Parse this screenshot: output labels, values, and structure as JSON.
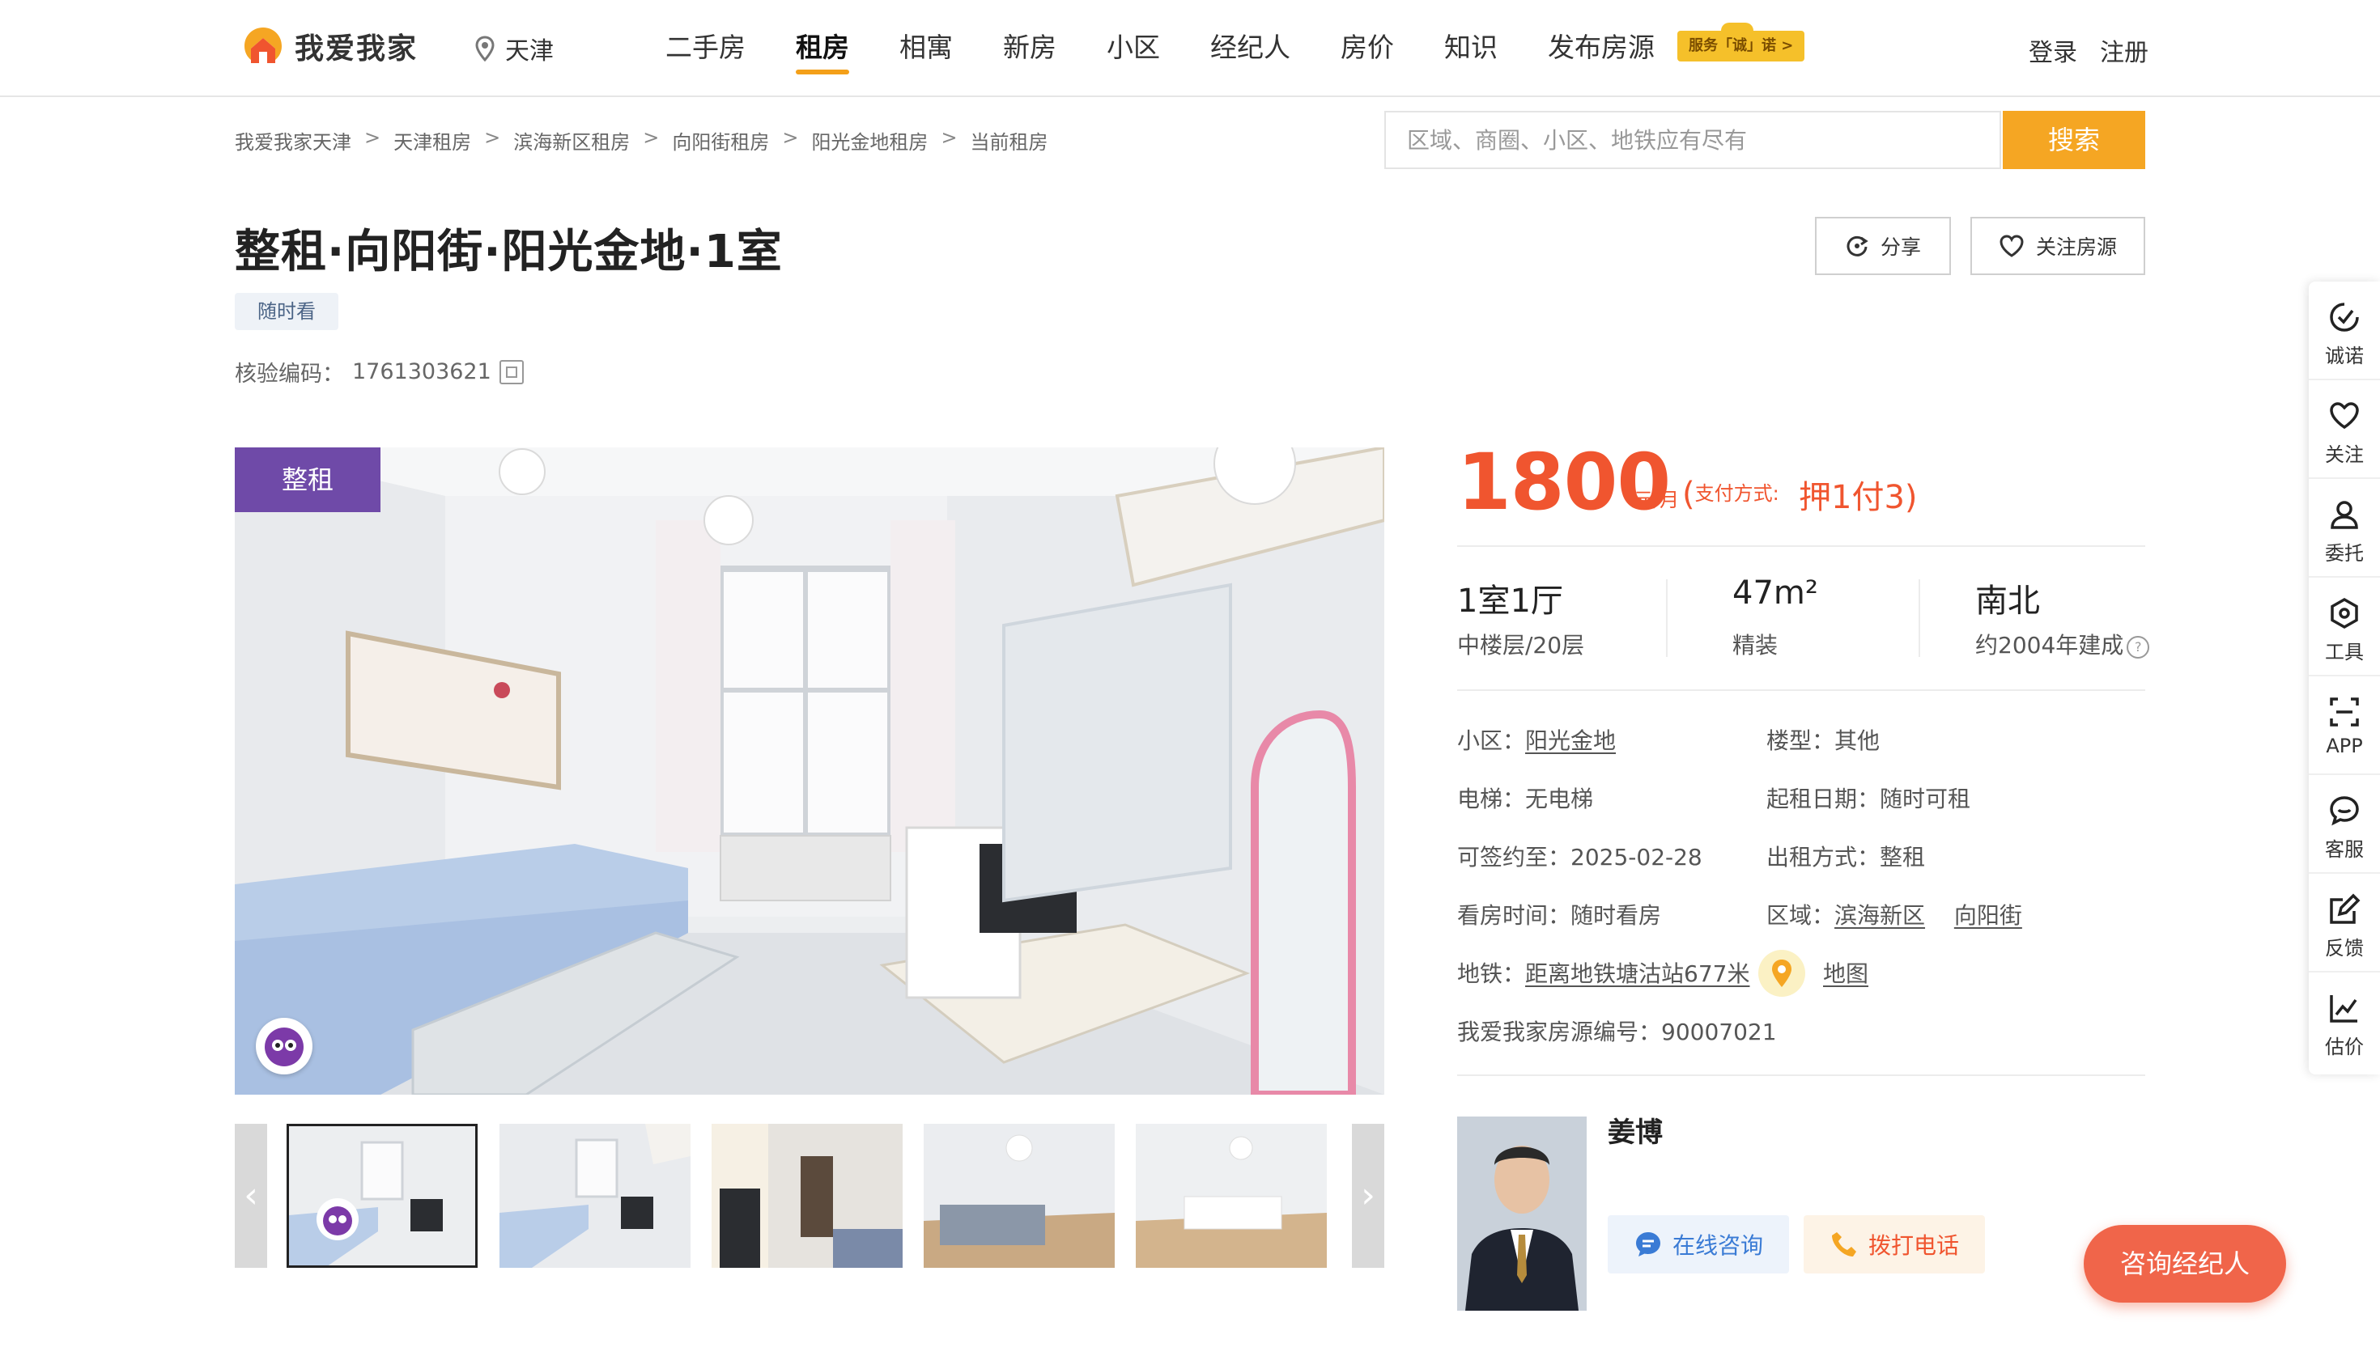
{
  "header": {
    "logo_text": "我爱我家",
    "city": "天津",
    "nav": [
      "二手房",
      "租房",
      "相寓",
      "新房",
      "小区",
      "经纪人",
      "房价",
      "知识",
      "发布房源"
    ],
    "active_nav_index": 1,
    "promise_badge": "服务「诚」诺 >",
    "login": "登录",
    "register": "注册"
  },
  "breadcrumb": [
    "我爱我家天津",
    "天津租房",
    "滨海新区租房",
    "向阳街租房",
    "阳光金地租房",
    "当前租房"
  ],
  "breadcrumb_sep": ">",
  "search": {
    "placeholder": "区域、商圈、小区、地铁应有尽有",
    "button": "搜索"
  },
  "listing": {
    "title": "整租·向阳街·阳光金地·1室",
    "tag": "随时看",
    "verify_label": "核验编码：",
    "verify_code": "1761303621",
    "share": "分享",
    "follow": "关注房源"
  },
  "gallery": {
    "type_badge": "整租",
    "thumb_count": 5,
    "active_thumb": 0
  },
  "price": {
    "value": "1800",
    "unit": "元/月",
    "pay_label": "支付方式:",
    "pay_value": "押1付3"
  },
  "summary": {
    "layout": "1室1厅",
    "floor": "中楼层/20层",
    "area": "47m²",
    "decoration": "精装",
    "orientation": "南北",
    "built": "约2004年建成"
  },
  "details": {
    "community_label": "小区：",
    "community": "阳光金地",
    "building_type_label": "楼型：",
    "building_type": "其他",
    "elevator_label": "电梯：",
    "elevator": "无电梯",
    "start_date_label": "起租日期：",
    "start_date": "随时可租",
    "sign_until_label": "可签约至：",
    "sign_until": "2025-02-28",
    "rent_mode_label": "出租方式：",
    "rent_mode": "整租",
    "viewing_label": "看房时间：",
    "viewing": "随时看房",
    "area_label": "区域：",
    "district": "滨海新区",
    "street": "向阳街",
    "subway_label": "地铁：",
    "subway": "距离地铁塘沽站677米",
    "map": "地图",
    "listing_no_label": "我爱我家房源编号：",
    "listing_no": "90007021"
  },
  "agent": {
    "name": "姜博",
    "chat": "在线咨询",
    "call": "拨打电话",
    "consult": "咨询经纪人"
  },
  "float_bar": [
    "诚诺",
    "关注",
    "委托",
    "工具",
    "APP",
    "客服",
    "反馈",
    "估价"
  ],
  "colors": {
    "accent": "#f5a623",
    "price": "#f0552f",
    "purple": "#6f4aa8",
    "blue": "#3a7bd5"
  }
}
